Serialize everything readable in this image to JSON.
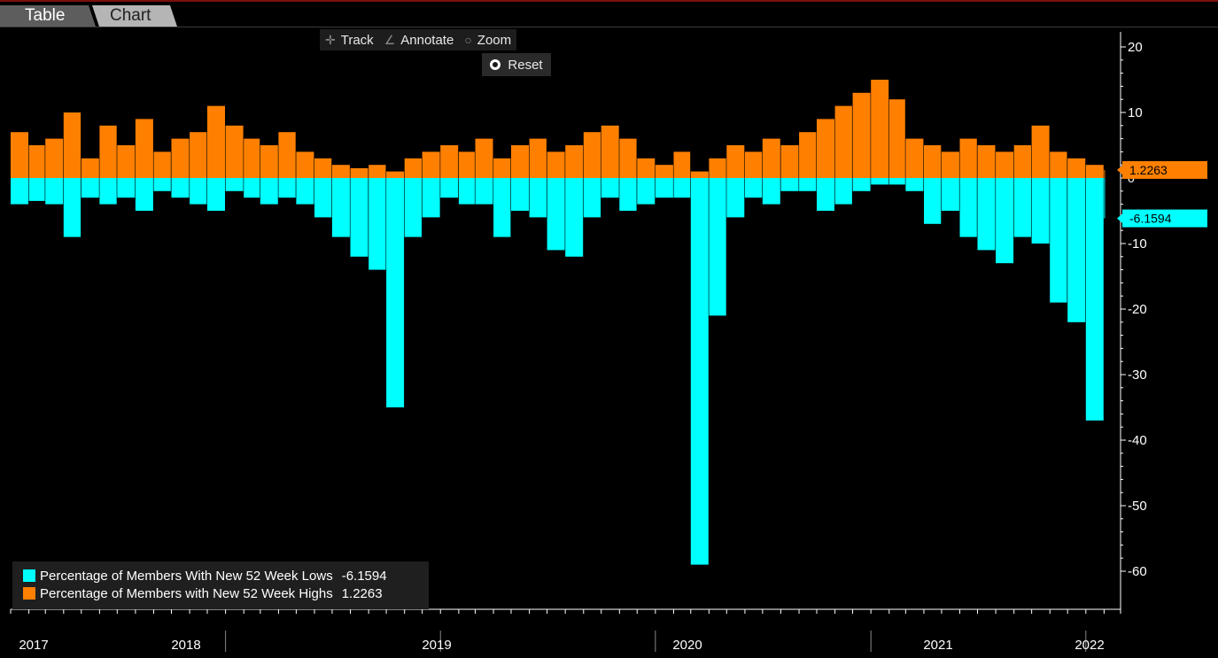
{
  "tabs": [
    {
      "label": "Table",
      "active": false
    },
    {
      "label": "Chart",
      "active": true
    }
  ],
  "toolbar": {
    "track_label": "Track",
    "annotate_label": "Annotate",
    "zoom_label": "Zoom",
    "reset_label": "Reset"
  },
  "colors": {
    "lows": "#00ffff",
    "highs": "#ff8000",
    "background": "#000000"
  },
  "chart_data": {
    "type": "bar",
    "ylim": [
      -65,
      22
    ],
    "y_ticks": [
      20,
      10,
      0,
      -10,
      -20,
      -30,
      -40,
      -50,
      -60
    ],
    "x_range": [
      "2017-01",
      "2022-03"
    ],
    "x_tick_labels": [
      "2017",
      "2018",
      "2019",
      "2020",
      "2021",
      "2022"
    ],
    "grid": false,
    "legend_position": "bottom-left",
    "series": [
      {
        "name": "Percentage of Members With New 52 Week Lows",
        "last_value": "-6.1594",
        "color": "#00ffff",
        "x": [
          "2017-01",
          "2017-02",
          "2017-03",
          "2017-04",
          "2017-05",
          "2017-06",
          "2017-07",
          "2017-08",
          "2017-09",
          "2017-10",
          "2017-11",
          "2017-12",
          "2018-01",
          "2018-02",
          "2018-03",
          "2018-04",
          "2018-05",
          "2018-06",
          "2018-07",
          "2018-08",
          "2018-09",
          "2018-10",
          "2018-11",
          "2018-12",
          "2019-01",
          "2019-02",
          "2019-03",
          "2019-04",
          "2019-05",
          "2019-06",
          "2019-07",
          "2019-08",
          "2019-09",
          "2019-10",
          "2019-11",
          "2019-12",
          "2020-01",
          "2020-02",
          "2020-03",
          "2020-04",
          "2020-05",
          "2020-06",
          "2020-07",
          "2020-08",
          "2020-09",
          "2020-10",
          "2020-11",
          "2020-12",
          "2021-01",
          "2021-02",
          "2021-03",
          "2021-04",
          "2021-05",
          "2021-06",
          "2021-07",
          "2021-08",
          "2021-09",
          "2021-10",
          "2021-11",
          "2021-12",
          "2022-01",
          "2022-02"
        ],
        "values": [
          -4,
          -3.5,
          -4,
          -9,
          -3,
          -4,
          -3,
          -5,
          -2,
          -3,
          -4,
          -5,
          -2,
          -3,
          -4,
          -3,
          -4,
          -6,
          -9,
          -12,
          -14,
          -35,
          -9,
          -6,
          -3,
          -4,
          -4,
          -9,
          -5,
          -6,
          -11,
          -12,
          -6,
          -3,
          -5,
          -4,
          -3,
          -3,
          -59,
          -21,
          -6,
          -3,
          -4,
          -2,
          -2,
          -5,
          -4,
          -2,
          -1,
          -1,
          -2,
          -7,
          -5,
          -9,
          -11,
          -13,
          -9,
          -10,
          -19,
          -22,
          -37,
          -6.1594
        ]
      },
      {
        "name": "Percentage of Members with New 52 Week Highs",
        "last_value": "1.2263",
        "color": "#ff8000",
        "x": [
          "2017-01",
          "2017-02",
          "2017-03",
          "2017-04",
          "2017-05",
          "2017-06",
          "2017-07",
          "2017-08",
          "2017-09",
          "2017-10",
          "2017-11",
          "2017-12",
          "2018-01",
          "2018-02",
          "2018-03",
          "2018-04",
          "2018-05",
          "2018-06",
          "2018-07",
          "2018-08",
          "2018-09",
          "2018-10",
          "2018-11",
          "2018-12",
          "2019-01",
          "2019-02",
          "2019-03",
          "2019-04",
          "2019-05",
          "2019-06",
          "2019-07",
          "2019-08",
          "2019-09",
          "2019-10",
          "2019-11",
          "2019-12",
          "2020-01",
          "2020-02",
          "2020-03",
          "2020-04",
          "2020-05",
          "2020-06",
          "2020-07",
          "2020-08",
          "2020-09",
          "2020-10",
          "2020-11",
          "2020-12",
          "2021-01",
          "2021-02",
          "2021-03",
          "2021-04",
          "2021-05",
          "2021-06",
          "2021-07",
          "2021-08",
          "2021-09",
          "2021-10",
          "2021-11",
          "2021-12",
          "2022-01",
          "2022-02"
        ],
        "values": [
          7,
          5,
          6,
          10,
          3,
          8,
          5,
          9,
          4,
          6,
          7,
          11,
          8,
          6,
          5,
          7,
          4,
          3,
          2,
          1.5,
          2,
          1,
          3,
          4,
          5,
          4,
          6,
          3,
          5,
          6,
          4,
          5,
          7,
          8,
          6,
          3,
          2,
          4,
          1,
          3,
          5,
          4,
          6,
          5,
          7,
          9,
          11,
          13,
          15,
          12,
          6,
          5,
          4,
          6,
          5,
          4,
          5,
          8,
          4,
          3,
          2,
          1.2263
        ]
      }
    ]
  }
}
